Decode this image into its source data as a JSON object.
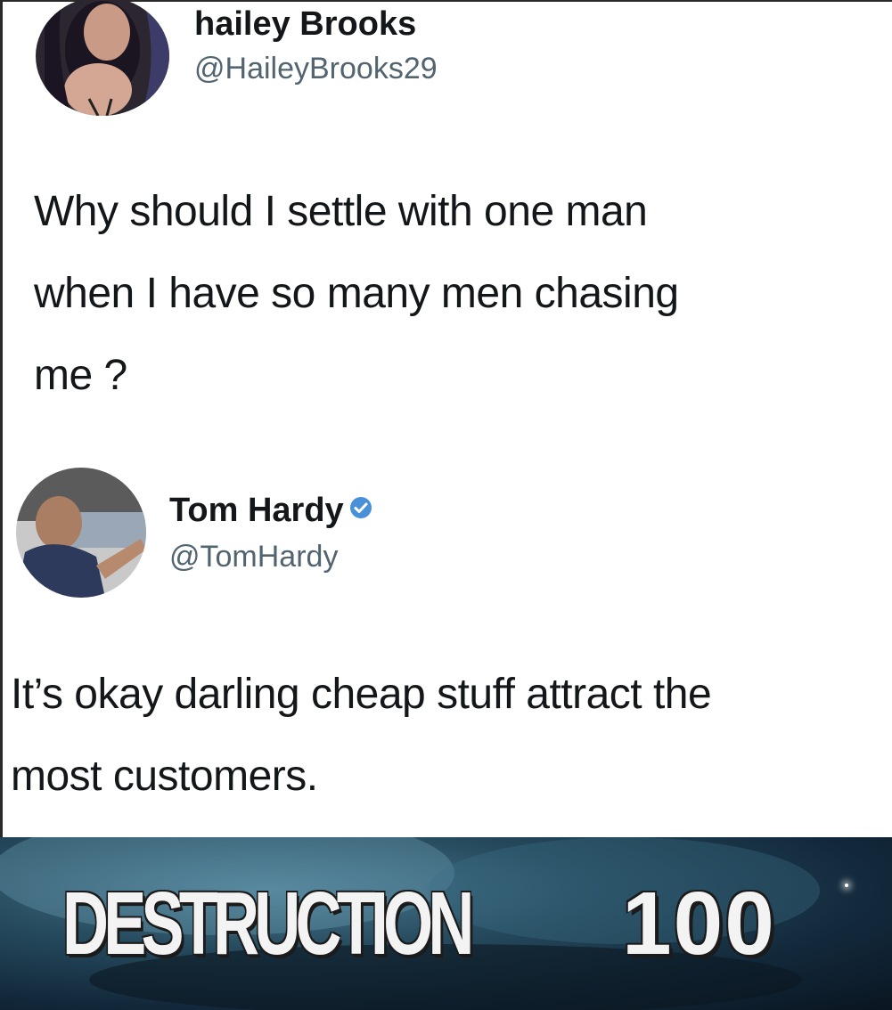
{
  "tweets": [
    {
      "name": "hailey Brooks",
      "handle": "@HaileyBrooks29",
      "verified": false,
      "lines": [
        "Why should I settle with one man",
        "when I have so many men chasing",
        "me ?"
      ]
    },
    {
      "name": "Tom Hardy",
      "handle": "@TomHardy",
      "verified": true,
      "lines": [
        "It’s okay darling cheap stuff attract the",
        "most customers."
      ]
    }
  ],
  "banner": {
    "word": "DESTRUCTION",
    "number": "100"
  },
  "colors": {
    "verified_badge": "#4a90d9",
    "handle_text": "#536471",
    "banner_dark": "#12283a"
  }
}
